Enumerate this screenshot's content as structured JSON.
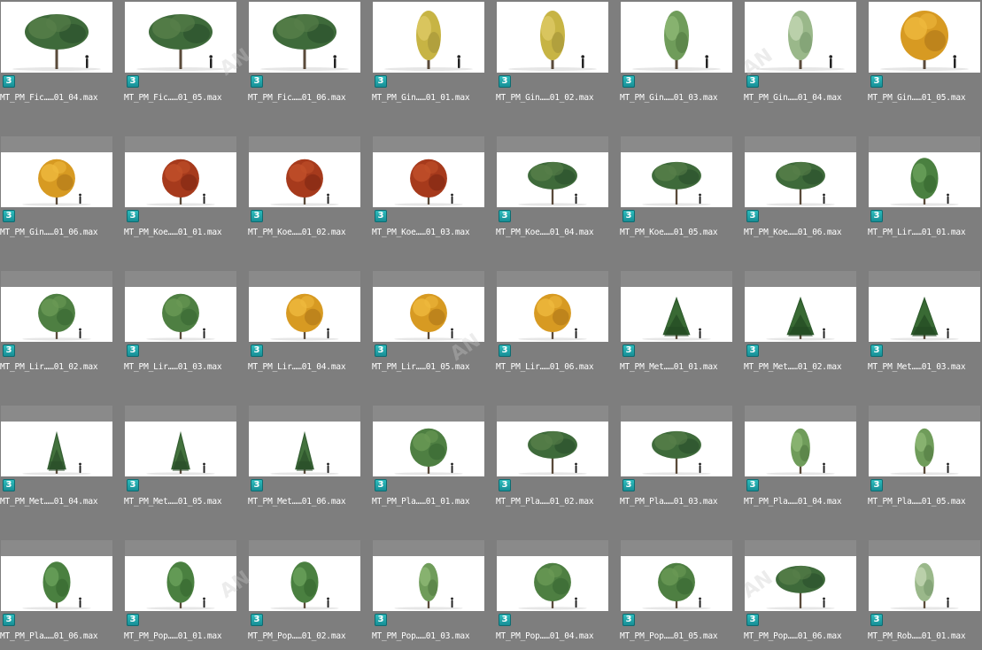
{
  "badge_text": "3",
  "files": [
    {
      "name": "MT_PM_Fic……01_04.max",
      "tree": "broad-green"
    },
    {
      "name": "MT_PM_Fic……01_05.max",
      "tree": "broad-green"
    },
    {
      "name": "MT_PM_Fic……01_06.max",
      "tree": "broad-green"
    },
    {
      "name": "MT_PM_Gin……01_01.max",
      "tree": "slim-yellow"
    },
    {
      "name": "MT_PM_Gin……01_02.max",
      "tree": "slim-yellow"
    },
    {
      "name": "MT_PM_Gin……01_03.max",
      "tree": "slim-green"
    },
    {
      "name": "MT_PM_Gin……01_04.max",
      "tree": "slim-pale"
    },
    {
      "name": "MT_PM_Gin……01_05.max",
      "tree": "round-gold"
    },
    {
      "name": "MT_PM_Gin……01_06.max",
      "tree": "round-gold"
    },
    {
      "name": "MT_PM_Koe……01_01.max",
      "tree": "round-red"
    },
    {
      "name": "MT_PM_Koe……01_02.max",
      "tree": "round-red"
    },
    {
      "name": "MT_PM_Koe……01_03.max",
      "tree": "round-red"
    },
    {
      "name": "MT_PM_Koe……01_04.max",
      "tree": "broad-green"
    },
    {
      "name": "MT_PM_Koe……01_05.max",
      "tree": "broad-green"
    },
    {
      "name": "MT_PM_Koe……01_06.max",
      "tree": "broad-green"
    },
    {
      "name": "MT_PM_Lir……01_01.max",
      "tree": "oval-green"
    },
    {
      "name": "MT_PM_Lir……01_02.max",
      "tree": "round-green"
    },
    {
      "name": "MT_PM_Lir……01_03.max",
      "tree": "round-green"
    },
    {
      "name": "MT_PM_Lir……01_04.max",
      "tree": "round-gold"
    },
    {
      "name": "MT_PM_Lir……01_05.max",
      "tree": "round-gold"
    },
    {
      "name": "MT_PM_Lir……01_06.max",
      "tree": "round-gold"
    },
    {
      "name": "MT_PM_Met……01_01.max",
      "tree": "conifer"
    },
    {
      "name": "MT_PM_Met……01_02.max",
      "tree": "conifer"
    },
    {
      "name": "MT_PM_Met……01_03.max",
      "tree": "conifer"
    },
    {
      "name": "MT_PM_Met……01_04.max",
      "tree": "conifer-slim"
    },
    {
      "name": "MT_PM_Met……01_05.max",
      "tree": "conifer-slim"
    },
    {
      "name": "MT_PM_Met……01_06.max",
      "tree": "conifer-slim"
    },
    {
      "name": "MT_PM_Pla……01_01.max",
      "tree": "round-green"
    },
    {
      "name": "MT_PM_Pla……01_02.max",
      "tree": "broad-green"
    },
    {
      "name": "MT_PM_Pla……01_03.max",
      "tree": "broad-green"
    },
    {
      "name": "MT_PM_Pla……01_04.max",
      "tree": "slim-green"
    },
    {
      "name": "MT_PM_Pla……01_05.max",
      "tree": "slim-green"
    },
    {
      "name": "MT_PM_Pla……01_06.max",
      "tree": "oval-green"
    },
    {
      "name": "MT_PM_Pop……01_01.max",
      "tree": "oval-green"
    },
    {
      "name": "MT_PM_Pop……01_02.max",
      "tree": "oval-green"
    },
    {
      "name": "MT_PM_Pop……01_03.max",
      "tree": "slim-green"
    },
    {
      "name": "MT_PM_Pop……01_04.max",
      "tree": "round-green"
    },
    {
      "name": "MT_PM_Pop……01_05.max",
      "tree": "round-green"
    },
    {
      "name": "MT_PM_Pop……01_06.max",
      "tree": "broad-green"
    },
    {
      "name": "MT_PM_Rob……01_01.max",
      "tree": "slim-pale"
    }
  ],
  "colors": {
    "background": "#7e7e7e",
    "thumb_bg": "#ffffff",
    "badge": "#1fa3a8",
    "label_text": "#ffffff"
  }
}
